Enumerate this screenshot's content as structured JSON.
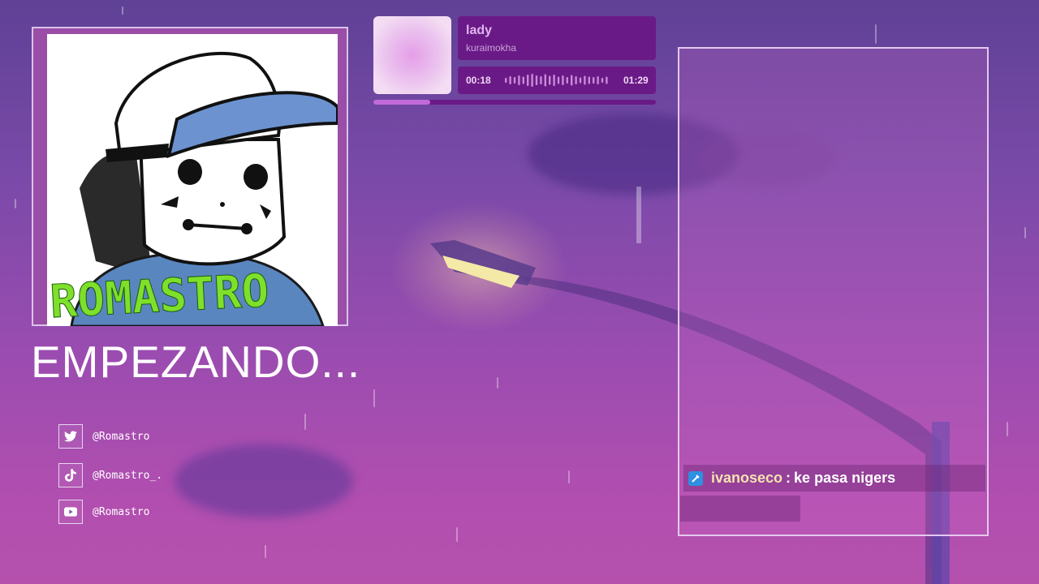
{
  "avatar": {
    "logo_text": "ROMASTRO"
  },
  "stream_status": "EMPEZANDO...",
  "socials": [
    {
      "icon": "twitter-icon",
      "handle": "@Romastro"
    },
    {
      "icon": "tiktok-icon",
      "handle": "@Romastro_."
    },
    {
      "icon": "youtube-icon",
      "handle": "@Romastro"
    }
  ],
  "player": {
    "track": "lady",
    "artist": "kuraimokha",
    "elapsed": "00:18",
    "duration": "01:29",
    "progress_fraction": 0.2
  },
  "chat": {
    "messages": [
      {
        "user": "ivanoseco",
        "separator": ":",
        "text": "ke pasa nigers",
        "badge": "moderator-sword-icon"
      }
    ]
  },
  "colors": {
    "accent": "#6a1a86",
    "progress": "#c26ad9",
    "username": "#f3e3b0",
    "logo_green": "#7ee02a"
  }
}
